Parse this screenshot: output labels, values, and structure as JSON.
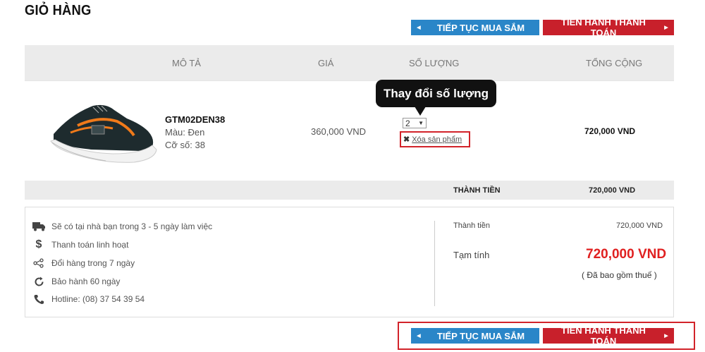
{
  "page": {
    "title": "GIỎ HÀNG"
  },
  "buttons": {
    "continue": "TIẾP TỤC MUA SẮM",
    "checkout": "TIẾN HÀNH THANH TOÁN"
  },
  "table": {
    "headers": {
      "description": "MÔ TẢ",
      "price": "GIÁ",
      "quantity": "SỐ LƯỢNG",
      "total": "TỔNG CỘNG"
    }
  },
  "item": {
    "sku": "GTM02DEN38",
    "color": "Màu: Đen",
    "size": "Cỡ số: 38",
    "price": "360,000 VND",
    "quantity": "2",
    "remove_label": "Xóa sản phẩm",
    "line_total": "720,000 VND"
  },
  "tooltip": {
    "text": "Thay đổi số lượng"
  },
  "summary_bar": {
    "label": "THÀNH TIỀN",
    "value": "720,000 VND"
  },
  "features": [
    {
      "icon": "truck-icon",
      "text": "Sẽ có tại nhà bạn trong 3 - 5 ngày làm việc"
    },
    {
      "icon": "dollar-icon",
      "text": "Thanh toán linh hoạt"
    },
    {
      "icon": "share-icon",
      "text": "Đổi hàng trong 7 ngày"
    },
    {
      "icon": "refresh-icon",
      "text": "Bảo hành 60 ngày"
    },
    {
      "icon": "phone-icon",
      "text": "Hotline: (08) 37 54 39 54"
    }
  ],
  "totals": {
    "subtotal_label": "Thành tiền",
    "subtotal_value": "720,000 VND",
    "estimate_label": "Tạm tính",
    "estimate_value": "720,000 VND",
    "tax_note": "( Đã bao gồm thuế )"
  },
  "colors": {
    "blue": "#2a86c8",
    "red": "#c8202b",
    "price_red": "#e02020",
    "highlight": "#d2232a"
  }
}
